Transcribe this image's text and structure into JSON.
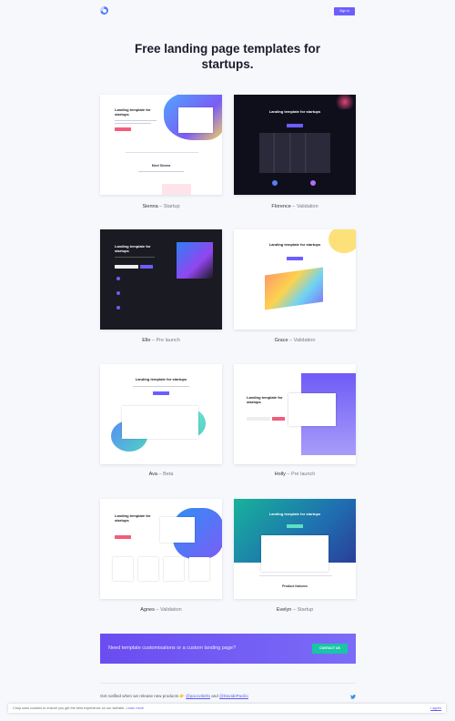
{
  "header": {
    "logo_icon": "cruip-logo-icon",
    "signin_label": "Sign in",
    "accent": "#6d5efc"
  },
  "hero": {
    "title": "Free landing page templates for startups."
  },
  "templates": [
    {
      "name": "Sienna",
      "tag": "Startup",
      "preview_title": "Landing template for startups",
      "preview_section": "Meet Sienna"
    },
    {
      "name": "Florence",
      "tag": "Validation",
      "preview_title": "Landing template for startups"
    },
    {
      "name": "Elle",
      "tag": "Pre launch",
      "preview_title": "Landing template for startups"
    },
    {
      "name": "Grace",
      "tag": "Validation",
      "preview_title": "Landing template for startups"
    },
    {
      "name": "Ava",
      "tag": "Beta",
      "preview_title": "Landing template for startups"
    },
    {
      "name": "Holly",
      "tag": "Pre launch",
      "preview_title": "Landing template for startups"
    },
    {
      "name": "Agnes",
      "tag": "Validation",
      "preview_title": "Landing template for startups"
    },
    {
      "name": "Evelyn",
      "tag": "Startup",
      "preview_title": "Landing template for startups",
      "preview_section": "Product features"
    }
  ],
  "caption_separator": " – ",
  "banner": {
    "text": "Need template customisations or a custom landing page?",
    "button_label": "CONTACT US"
  },
  "footer": {
    "text": "Get notified when we release new products 👉",
    "link1": "@pacovitiello",
    "and": "and",
    "link2": "@DavidePacilio",
    "twitter_icon": "twitter-icon"
  },
  "cookie": {
    "text": "Cruip uses cookies to ensure you get the best experience on our website.",
    "learn_more": "Learn more",
    "agree": "I agree"
  }
}
